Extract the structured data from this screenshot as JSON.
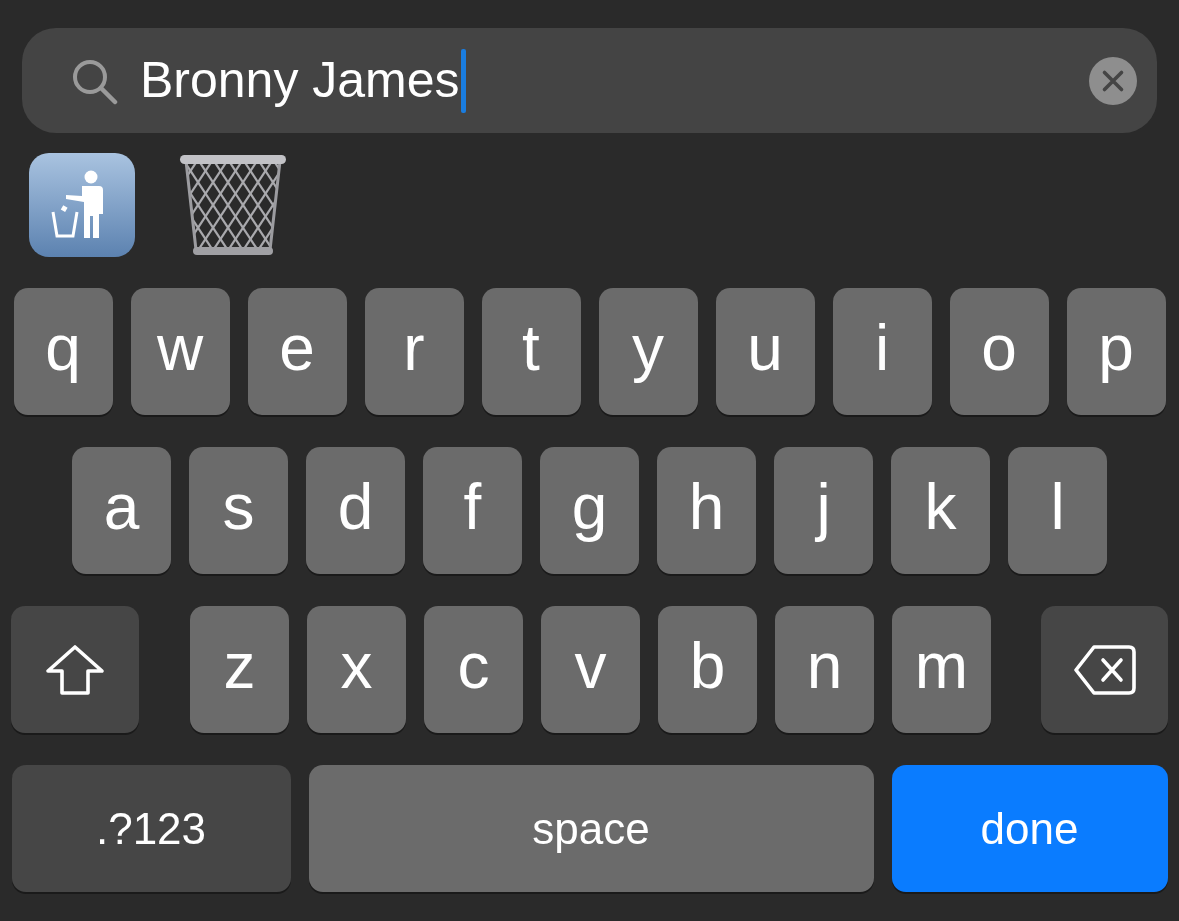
{
  "search_field": {
    "value": "Bronny James",
    "focused": true
  },
  "emoji_suggestions": [
    {
      "kind": "litter_sign"
    },
    {
      "kind": "wastebasket"
    }
  ],
  "keyboard": {
    "key_rows": [
      {
        "keys": [
          {
            "kind": "letter",
            "label": "q"
          },
          {
            "kind": "letter",
            "label": "w"
          },
          {
            "kind": "letter",
            "label": "e"
          },
          {
            "kind": "letter",
            "label": "r"
          },
          {
            "kind": "letter",
            "label": "t"
          },
          {
            "kind": "letter",
            "label": "y"
          },
          {
            "kind": "letter",
            "label": "u"
          },
          {
            "kind": "letter",
            "label": "i"
          },
          {
            "kind": "letter",
            "label": "o"
          },
          {
            "kind": "letter",
            "label": "p"
          }
        ]
      },
      {
        "keys": [
          {
            "kind": "letter",
            "label": "a"
          },
          {
            "kind": "letter",
            "label": "s"
          },
          {
            "kind": "letter",
            "label": "d"
          },
          {
            "kind": "letter",
            "label": "f"
          },
          {
            "kind": "letter",
            "label": "g"
          },
          {
            "kind": "letter",
            "label": "h"
          },
          {
            "kind": "letter",
            "label": "j"
          },
          {
            "kind": "letter",
            "label": "k"
          },
          {
            "kind": "letter",
            "label": "l"
          }
        ]
      },
      {
        "keys": [
          {
            "kind": "shift"
          },
          {
            "kind": "letter",
            "label": "z"
          },
          {
            "kind": "letter",
            "label": "x"
          },
          {
            "kind": "letter",
            "label": "c"
          },
          {
            "kind": "letter",
            "label": "v"
          },
          {
            "kind": "letter",
            "label": "b"
          },
          {
            "kind": "letter",
            "label": "n"
          },
          {
            "kind": "letter",
            "label": "m"
          },
          {
            "kind": "backspace"
          }
        ]
      },
      {
        "keys": [
          {
            "kind": "numbers",
            "label": ".?123"
          },
          {
            "kind": "space",
            "label": "space"
          },
          {
            "kind": "done",
            "label": "done"
          }
        ]
      }
    ]
  }
}
